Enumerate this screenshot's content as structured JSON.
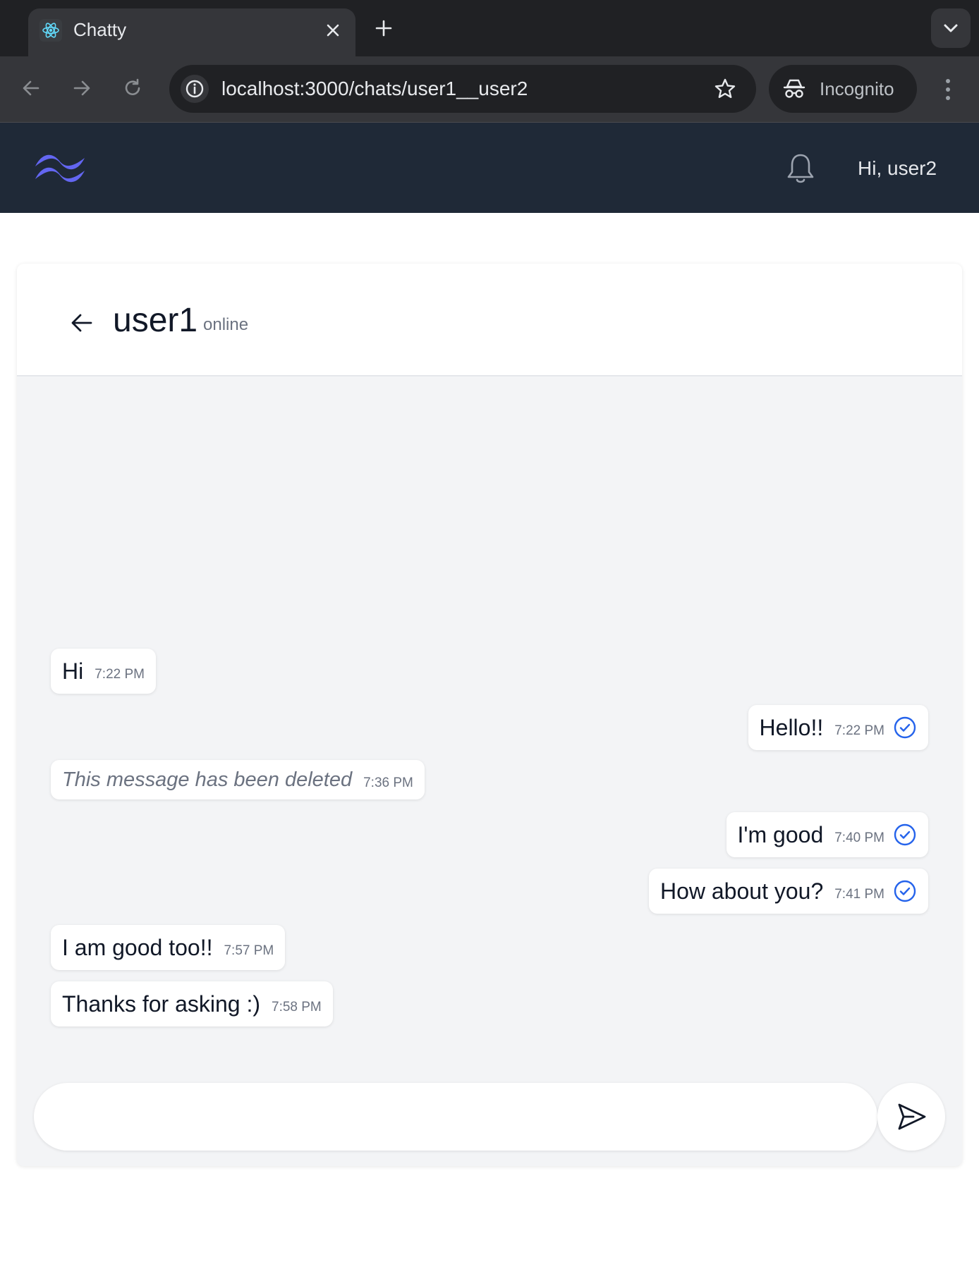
{
  "browser": {
    "tab_title": "Chatty",
    "url": "localhost:3000/chats/user1__user2",
    "incognito_label": "Incognito"
  },
  "app": {
    "greeting": "Hi, user2",
    "accent_color": "#6366f1",
    "header_bg": "#1f2937"
  },
  "chat": {
    "peer_name": "user1",
    "peer_status": "online",
    "composer_value": "",
    "messages": [
      {
        "side": "left",
        "text": "Hi",
        "time": "7:22 PM"
      },
      {
        "side": "right",
        "text": "Hello!!",
        "time": "7:22 PM",
        "read_icon": "check-circle-icon"
      },
      {
        "side": "left",
        "text": "This message has been deleted",
        "time": "7:36 PM",
        "deleted": true
      },
      {
        "side": "right",
        "text": "I'm good",
        "time": "7:40 PM",
        "read_icon": "check-circle-icon"
      },
      {
        "side": "right",
        "text": "How about you?",
        "time": "7:41 PM",
        "read_icon": "check-circle-icon"
      },
      {
        "side": "left",
        "text": "I am good too!!",
        "time": "7:57 PM"
      },
      {
        "side": "left",
        "text": "Thanks for asking :)",
        "time": "7:58 PM"
      }
    ]
  }
}
